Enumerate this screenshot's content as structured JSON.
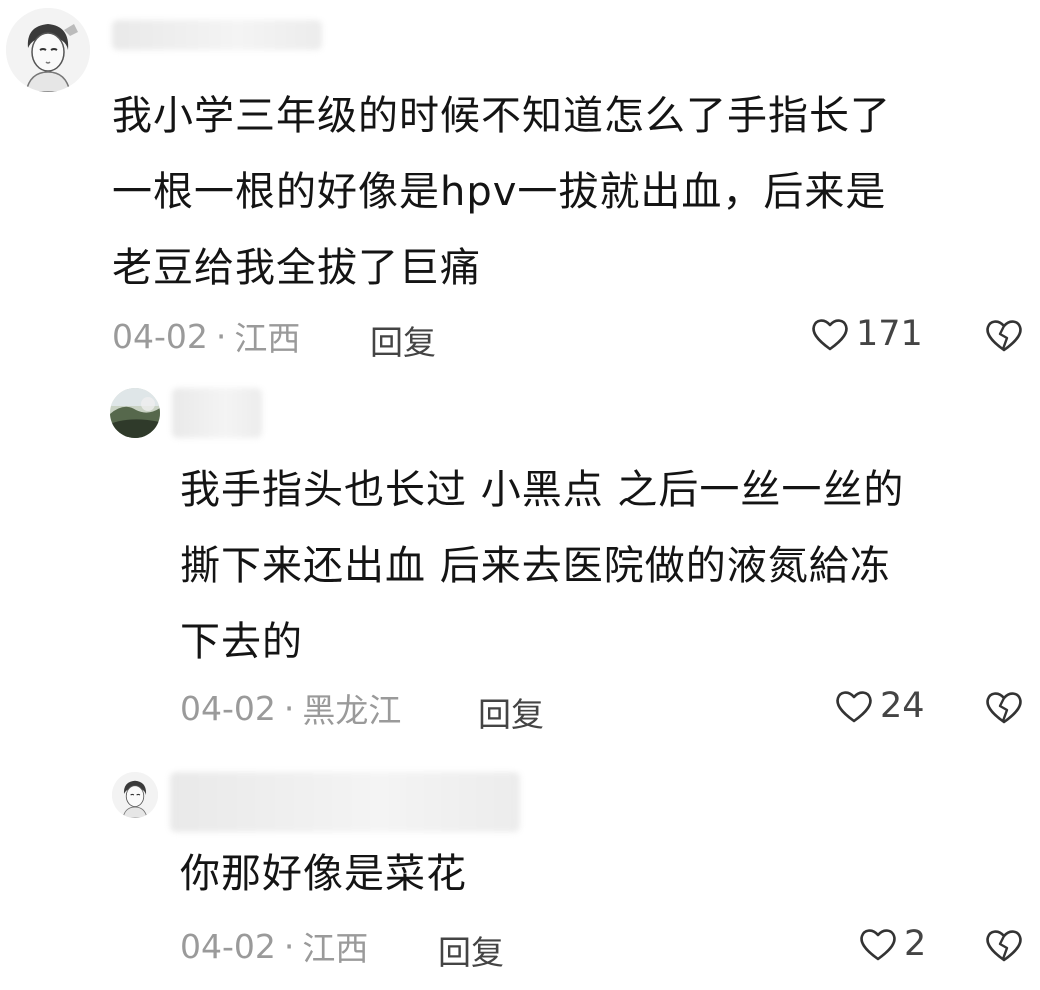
{
  "comments": [
    {
      "text": "我小学三年级的时候不知道怎么了手指长了\n一根一根的好像是hpv一拔就出血，后来是\n老豆给我全拔了巨痛",
      "date": "04-02",
      "location": "江西",
      "reply_label": "回复",
      "likes": "171"
    },
    {
      "text": "我手指头也长过 小黑点 之后一丝一丝的\n撕下来还出血 后来去医院做的液氮給冻\n下去的",
      "date": "04-02",
      "location": "黑龙江",
      "reply_label": "回复",
      "likes": "24"
    },
    {
      "text": "你那好像是菜花",
      "date": "04-02",
      "location": "江西",
      "reply_label": "回复",
      "likes": "2"
    }
  ],
  "meta_separator": "·",
  "icons": {
    "like": "heart-outline-icon",
    "dislike": "broken-heart-icon"
  }
}
